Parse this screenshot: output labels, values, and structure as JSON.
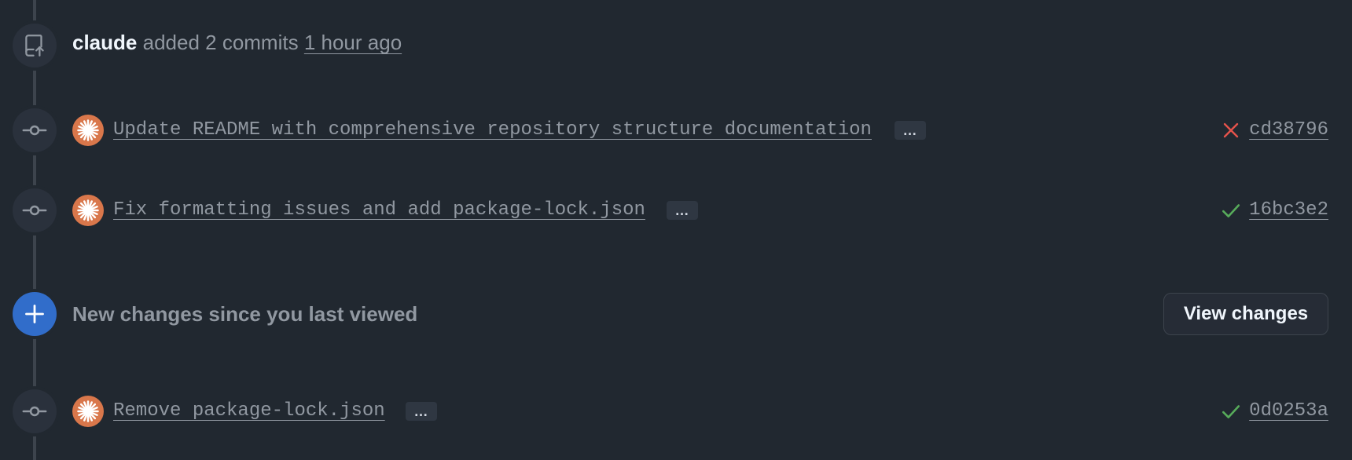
{
  "push_event": {
    "author": "claude",
    "action": "added 2 commits",
    "time": "1 hour ago",
    "icon": "repo-push-icon"
  },
  "commits": [
    {
      "message": "Update README with comprehensive repository structure documentation",
      "more_label": "…",
      "status": "failure",
      "sha": "cd38796"
    },
    {
      "message": "Fix formatting issues and add package-lock.json",
      "more_label": "…",
      "status": "success",
      "sha": "16bc3e2"
    },
    {
      "message": "Remove package-lock.json",
      "more_label": "…",
      "status": "success",
      "sha": "0d0253a"
    }
  ],
  "new_changes": {
    "text": "New changes since you last viewed",
    "button_label": "View changes"
  },
  "colors": {
    "background": "#212830",
    "accent_blue": "#316dca",
    "failure_red": "#e5534b",
    "success_green": "#57ab5a",
    "avatar_orange": "#d9774b"
  }
}
